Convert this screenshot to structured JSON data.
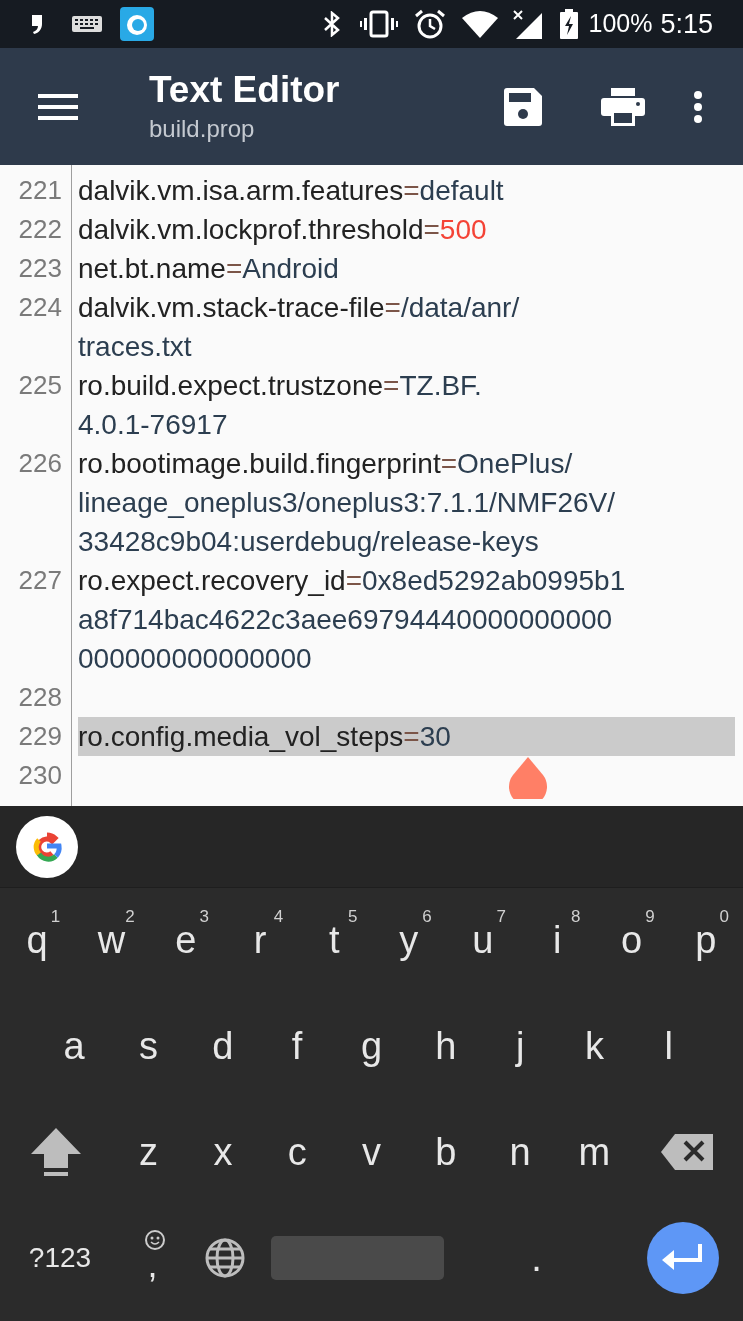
{
  "status_bar": {
    "battery_text": "100%",
    "time": "5:15"
  },
  "toolbar": {
    "title": "Text Editor",
    "subtitle": "build.prop"
  },
  "editor": {
    "lines": [
      {
        "number": "221",
        "key": "dalvik.vm.isa.arm.features",
        "separator": "=",
        "value": [
          "default"
        ],
        "color": "#2c3e50",
        "selected": false
      },
      {
        "number": "222",
        "key": "dalvik.vm.lockprof.threshold",
        "separator": "=",
        "value": [
          "500"
        ],
        "color": "#f44336",
        "selected": false
      },
      {
        "number": "223",
        "key": "net.bt.name",
        "separator": "=",
        "value": [
          "Android"
        ],
        "color": "#2c3e50",
        "selected": false
      },
      {
        "number": "224",
        "key": "dalvik.vm.stack-trace-file",
        "separator": "=",
        "value": [
          "/data/anr/",
          "traces.txt"
        ],
        "color": "#2c3e50",
        "selected": false
      },
      {
        "number": "225",
        "key": "ro.build.expect.trustzone",
        "separator": "=",
        "value": [
          "TZ.BF.",
          "4.0.1-76917"
        ],
        "color": "#2c3e50",
        "selected": false
      },
      {
        "number": "226",
        "key": "ro.bootimage.build.fingerprint",
        "separator": "=",
        "value": [
          "OnePlus/",
          "lineage_oneplus3/oneplus3:7.1.1/NMF26V/",
          "33428c9b04:userdebug/release-keys"
        ],
        "color": "#2c3e50",
        "selected": false
      },
      {
        "number": "227",
        "key": "ro.expect.recovery_id",
        "separator": "=",
        "value": [
          "0x8ed5292ab0995b1",
          "a8f714bac4622c3aee69794440000000000",
          "000000000000000"
        ],
        "color": "#2c3e50",
        "selected": false
      },
      {
        "number": "228",
        "selected": false
      },
      {
        "number": "229",
        "key": "ro.config.media_vol_steps",
        "separator": "=",
        "value": [
          "30"
        ],
        "color": "#2c3e50",
        "selected": true
      },
      {
        "number": "230",
        "selected": false
      }
    ]
  },
  "keyboard": {
    "rows": [
      {
        "keys": [
          {
            "kind": "char",
            "label": "q",
            "hint": "1"
          },
          {
            "kind": "char",
            "label": "w",
            "hint": "2"
          },
          {
            "kind": "char",
            "label": "e",
            "hint": "3"
          },
          {
            "kind": "char",
            "label": "r",
            "hint": "4"
          },
          {
            "kind": "char",
            "label": "t",
            "hint": "5"
          },
          {
            "kind": "char",
            "label": "y",
            "hint": "6"
          },
          {
            "kind": "char",
            "label": "u",
            "hint": "7"
          },
          {
            "kind": "char",
            "label": "i",
            "hint": "8"
          },
          {
            "kind": "char",
            "label": "o",
            "hint": "9"
          },
          {
            "kind": "char",
            "label": "p",
            "hint": "0"
          }
        ]
      },
      {
        "keys": [
          {
            "kind": "char",
            "label": "a"
          },
          {
            "kind": "char",
            "label": "s"
          },
          {
            "kind": "char",
            "label": "d"
          },
          {
            "kind": "char",
            "label": "f"
          },
          {
            "kind": "char",
            "label": "g"
          },
          {
            "kind": "char",
            "label": "h"
          },
          {
            "kind": "char",
            "label": "j"
          },
          {
            "kind": "char",
            "label": "k"
          },
          {
            "kind": "char",
            "label": "l"
          }
        ]
      },
      {
        "keys": [
          {
            "kind": "shift"
          },
          {
            "kind": "char",
            "label": "z"
          },
          {
            "kind": "char",
            "label": "x"
          },
          {
            "kind": "char",
            "label": "c"
          },
          {
            "kind": "char",
            "label": "v"
          },
          {
            "kind": "char",
            "label": "b"
          },
          {
            "kind": "char",
            "label": "n"
          },
          {
            "kind": "char",
            "label": "m"
          },
          {
            "kind": "backspace"
          }
        ]
      },
      {
        "keys": [
          {
            "kind": "symbols",
            "label": "?123"
          },
          {
            "kind": "emoji_comma",
            "label": ","
          },
          {
            "kind": "globe"
          },
          {
            "kind": "space"
          },
          {
            "kind": "char",
            "label": "."
          },
          {
            "kind": "enter"
          }
        ]
      }
    ]
  }
}
